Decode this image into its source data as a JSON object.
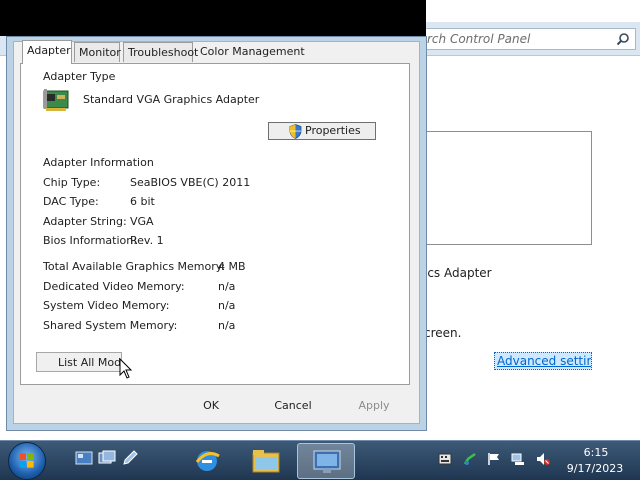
{
  "background_window": {
    "search_placeholder": "rch Control Panel",
    "adapter_text": "ics Adapter",
    "screen_text": "creen.",
    "advanced_link": "Advanced settings"
  },
  "dialog": {
    "tabs": [
      {
        "label": "Adapter",
        "active": true
      },
      {
        "label": "Monitor",
        "active": false
      },
      {
        "label": "Troubleshoot",
        "active": false
      },
      {
        "label": "Color Management",
        "active": false
      }
    ],
    "adapter_type": {
      "heading": "Adapter Type",
      "name": "Standard VGA Graphics Adapter",
      "properties_button": "Properties"
    },
    "adapter_info": {
      "heading": "Adapter Information",
      "rows": [
        {
          "label": "Chip Type:",
          "value": "SeaBIOS VBE(C) 2011"
        },
        {
          "label": "DAC Type:",
          "value": "6 bit"
        },
        {
          "label": "Adapter String:",
          "value": "VGA"
        },
        {
          "label": "Bios Information:",
          "value": "Rev. 1"
        }
      ]
    },
    "memory": [
      {
        "label": "Total Available Graphics Memory:",
        "value": "4 MB"
      },
      {
        "label": "Dedicated Video Memory:",
        "value": "n/a"
      },
      {
        "label": "System Video Memory:",
        "value": "n/a"
      },
      {
        "label": "Shared System Memory:",
        "value": "n/a"
      }
    ],
    "list_modes_button": "List All Modes",
    "buttons": {
      "ok": "OK",
      "cancel": "Cancel",
      "apply": "Apply"
    }
  },
  "taskbar": {
    "pinned": [
      "show-desktop-icon",
      "switch-windows-icon",
      "edit-icon"
    ],
    "tasks": [
      "internet-explorer-icon",
      "windows-explorer-icon",
      "display-settings-icon"
    ],
    "tray": [
      "keyboard-icon",
      "security-flag-icon",
      "action-center-flag-icon",
      "network-icon",
      "volume-muted-icon"
    ],
    "clock_time": "6:15",
    "clock_date": "9/17/2023"
  },
  "colors": {
    "taskbar": "#1f3650",
    "dialog_frame": "#bcd3e6",
    "link": "#0066cc"
  }
}
